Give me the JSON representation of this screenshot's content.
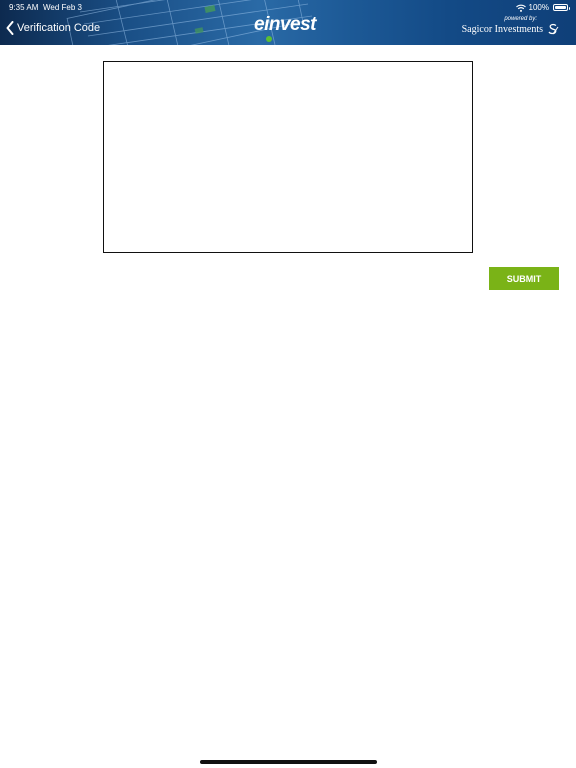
{
  "status_bar": {
    "time": "9:35 AM",
    "date": "Wed Feb 3",
    "battery": "100%",
    "icons": [
      "wifi-icon",
      "battery-icon"
    ]
  },
  "header": {
    "back_label": "Verification Code",
    "back_icon": "chevron-left-icon",
    "brand": "einvest",
    "powered_by": "powered by:",
    "powered_name": "Sagicor Investments",
    "powered_icon": "sagicor-logo-icon",
    "background_art": "stock-market-data-icon"
  },
  "form": {
    "code_input_value": "",
    "submit_label": "SUBMIT"
  },
  "colors": {
    "header_blue": "#1a4f86",
    "submit_green": "#7ab317",
    "brand_dot_green": "#5bbf32"
  }
}
